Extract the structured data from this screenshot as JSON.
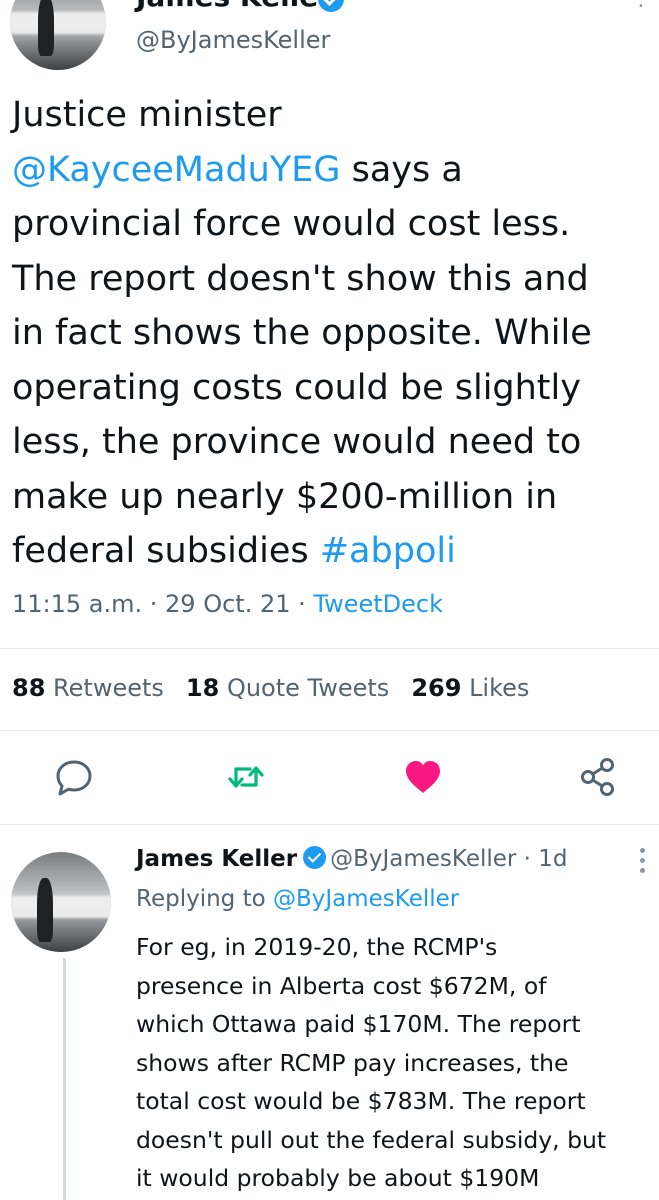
{
  "main_tweet": {
    "author_name": "James Keller",
    "handle": "@ByJamesKeller",
    "text_lines": [
      {
        "parts": [
          {
            "text": "Justice minister",
            "type": "text"
          }
        ]
      },
      {
        "parts": [
          {
            "text": "@KayceeMaduYEG",
            "type": "link"
          },
          {
            "text": " says a",
            "type": "text"
          }
        ]
      },
      {
        "parts": [
          {
            "text": "provincial force would cost less.",
            "type": "text"
          }
        ]
      },
      {
        "parts": [
          {
            "text": "The report doesn't show this and",
            "type": "text"
          }
        ]
      },
      {
        "parts": [
          {
            "text": "in fact shows the opposite. While",
            "type": "text"
          }
        ]
      },
      {
        "parts": [
          {
            "text": "operating costs could be slightly",
            "type": "text"
          }
        ]
      },
      {
        "parts": [
          {
            "text": "less, the province would need to",
            "type": "text"
          }
        ]
      },
      {
        "parts": [
          {
            "text": "make up nearly $200-million in",
            "type": "text"
          }
        ]
      },
      {
        "parts": [
          {
            "text": "federal subsidies ",
            "type": "text"
          },
          {
            "text": "#abpoli",
            "type": "link"
          }
        ]
      }
    ],
    "time": "11:15 a.m.",
    "date": "29 Oct. 21",
    "source": "TweetDeck",
    "separator": " · ",
    "stats": {
      "retweets_count": "88",
      "retweets_label": "Retweets",
      "quotes_count": "18",
      "quotes_label": "Quote Tweets",
      "likes_count": "269",
      "likes_label": "Likes"
    },
    "actions": [
      {
        "name": "reply-icon"
      },
      {
        "name": "retweet-icon"
      },
      {
        "name": "like-icon"
      },
      {
        "name": "share-icon"
      }
    ],
    "colors": {
      "link": "#1d9bf0",
      "retweet": "#00ba7c",
      "like": "#f91880",
      "muted": "#536471"
    }
  },
  "reply_tweet": {
    "author_name": "James Keller",
    "handle": "@ByJamesKeller",
    "age": "· 1d",
    "replying_prefix": "Replying to",
    "replying_to": "@ByJamesKeller",
    "text_lines": [
      "For eg, in 2019-20, the RCMP's",
      "presence in Alberta cost $672M, of",
      "which Ottawa paid $170M. The report",
      "shows after RCMP pay increases, the",
      "total cost would be $783M. The report",
      "doesn't pull out the federal subsidy, but",
      "it would probably be about $190M"
    ]
  }
}
